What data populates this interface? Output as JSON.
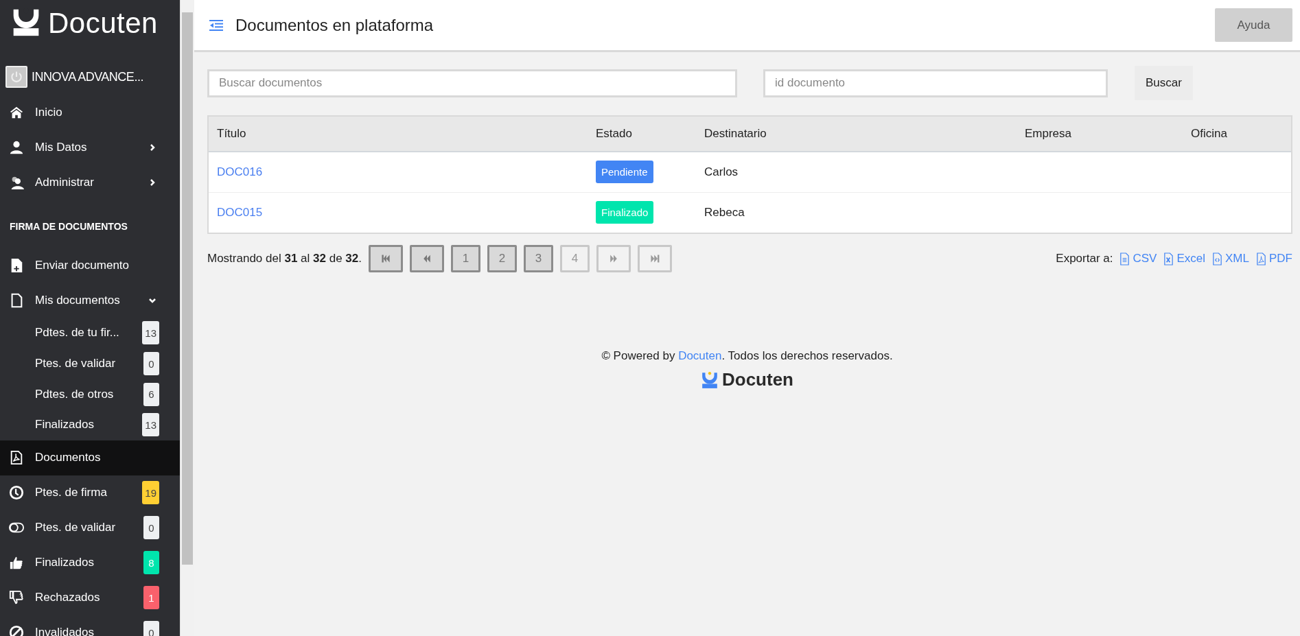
{
  "sidebar": {
    "logo": "Docuten",
    "user": {
      "name": "INNOVA ADVANCE..."
    },
    "items": [
      {
        "kind": "item",
        "label": "Inicio",
        "selected": false
      },
      {
        "kind": "item",
        "label": "Mis Datos",
        "selected": false,
        "expanded": false
      },
      {
        "kind": "item",
        "label": "Administrar",
        "selected": false,
        "expanded": false
      },
      {
        "kind": "section",
        "label": "FIRMA DE DOCUMENTOS"
      },
      {
        "kind": "item",
        "label": "Enviar documento",
        "selected": false
      },
      {
        "kind": "item",
        "label": "Mis documentos",
        "selected": false,
        "expanded": true,
        "children": [
          {
            "kind": "item",
            "label": "Pdtes. de tu fir...",
            "selected": false,
            "badge": "13",
            "color": "#eef0f2"
          },
          {
            "kind": "item",
            "label": "Ptes. de validar",
            "selected": false,
            "badge": "0",
            "color": "#eef0f2"
          },
          {
            "kind": "item",
            "label": "Pdtes. de otros",
            "selected": false,
            "badge": "6",
            "color": "#eef0f2"
          },
          {
            "kind": "item",
            "label": "Finalizados",
            "selected": false,
            "badge": "13",
            "color": "#eef0f2"
          }
        ]
      },
      {
        "kind": "item",
        "label": "Documentos",
        "selected": true
      },
      {
        "kind": "item",
        "label": "Ptes. de firma",
        "selected": false,
        "badge": "19",
        "color": "#ffcf33"
      },
      {
        "kind": "item",
        "label": "Ptes. de validar",
        "selected": false,
        "badge": "0",
        "color": "#eef0f2"
      },
      {
        "kind": "item",
        "label": "Finalizados",
        "selected": false,
        "badge": "8",
        "color": "#00e5ad"
      },
      {
        "kind": "item",
        "label": "Rechazados",
        "selected": false,
        "badge": "1",
        "color": "#fa616c"
      },
      {
        "kind": "item",
        "label": "Invalidados",
        "selected": false,
        "badge": "0",
        "color": "#eef0f2"
      }
    ]
  },
  "header": {
    "title": "Documentos en plataforma",
    "help_button": "Ayuda"
  },
  "search": {
    "query": {
      "placeholder": "Buscar documentos"
    },
    "id": {
      "placeholder": "id documento"
    },
    "button": "Buscar"
  },
  "table": {
    "columns": [
      "Título",
      "Estado",
      "Destinatario",
      "Empresa",
      "Oficina"
    ],
    "rows": [
      {
        "title": "DOC016",
        "status": "Pendiente",
        "color": "#4285f4",
        "recipient": "Carlos"
      },
      {
        "title": "DOC015",
        "status": "Finalizado",
        "color": "#00e5ad",
        "recipient": "Rebeca"
      }
    ]
  },
  "pagination": {
    "summary": "Mostrando del **31** al **32** de **32**.",
    "buttons": [
      {
        "kind": "first",
        "disabled": false
      },
      {
        "kind": "prev",
        "disabled": false
      },
      {
        "kind": "page",
        "label": "1",
        "disabled": false
      },
      {
        "kind": "page",
        "label": "2",
        "disabled": false
      },
      {
        "kind": "page",
        "label": "3",
        "disabled": false
      },
      {
        "kind": "page",
        "label": "4",
        "disabled": true
      },
      {
        "kind": "next",
        "disabled": true
      },
      {
        "kind": "last",
        "disabled": true
      }
    ]
  },
  "export": {
    "label": "Exportar a:",
    "formats": [
      "CSV",
      "Excel",
      "XML",
      "PDF"
    ]
  },
  "footer": {
    "text_before": "© Powered by",
    "link": "Docuten",
    "text_after": ". Todos los derechos reservados.",
    "logo": "Docuten"
  }
}
